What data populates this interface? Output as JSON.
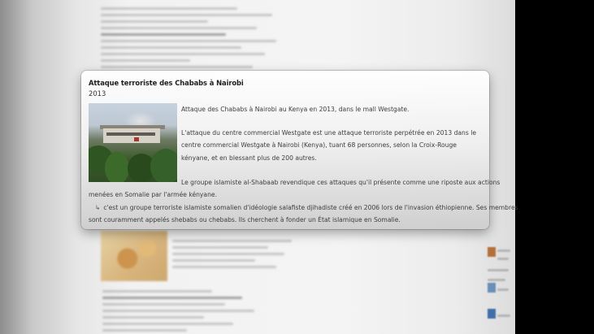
{
  "popup": {
    "title": "Attaque terroriste des Chababs à Nairobi",
    "year": "2013",
    "photo_alt_icon": "photo-westgate",
    "paragraph1": "Attaque des Chababs à Nairobi au Kenya en 2013, dans le mall Westgate.",
    "paragraph2": "L'attaque du centre commercial Westgate est une attaque terroriste perpétrée en 2013 dans le centre commercial Westgate à Nairobi (Kenya), tuant 68 personnes, selon la Croix-Rouge kényane, et en blessant plus de 200 autres.",
    "paragraph3_line1": "Le groupe islamiste al-Shabaab revendique ces attaques qu'il présente comme une riposte aux actions",
    "paragraph3_line2": "menées en Somalie par l'armée kényane.",
    "paragraph4_arrow": "↳",
    "paragraph4_line1": "c'est un groupe terroriste islamiste somalien d'idéologie salafiste djihadiste créé en 2006 lors de l'invasion éthiopienne. Ses membres",
    "paragraph4_line2": "sont couramment appelés shebabs  ou chebabs. Ils cherchent à fonder un État islamique en Somalie."
  },
  "colors": {
    "page_bg": "#f4f4f4",
    "popup_title": "#1e1e1e",
    "popup_text": "#3d3d3d"
  }
}
